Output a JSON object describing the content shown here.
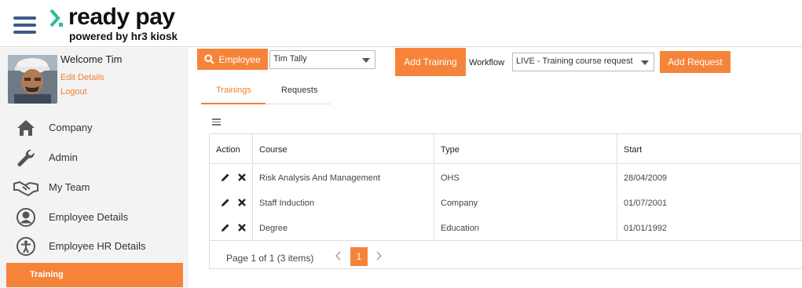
{
  "header": {
    "brand": "ready pay",
    "tagline": "powered by hr3 kiosk",
    "accent": "#f5843a",
    "menu_icon": "hamburger-icon"
  },
  "sidebar": {
    "welcome": "Welcome Tim",
    "edit_details": "Edit Details",
    "logout": "Logout",
    "items": [
      {
        "label": "Company",
        "icon": "home-icon"
      },
      {
        "label": "Admin",
        "icon": "wrench-icon"
      },
      {
        "label": "My Team",
        "icon": "handshake-icon"
      },
      {
        "label": "Employee Details",
        "icon": "user-circle-icon"
      },
      {
        "label": "Employee HR Details",
        "icon": "accessibility-icon"
      }
    ],
    "active_item": "Training"
  },
  "toolbar": {
    "employee_button": "Employee",
    "employee_value": "Tim Tally",
    "add_training": "Add Training",
    "workflow_label": "Workflow",
    "workflow_value": "LIVE - Training course request",
    "add_request": "Add Request"
  },
  "tabs": [
    {
      "label": "Trainings",
      "active": true
    },
    {
      "label": "Requests",
      "active": false
    }
  ],
  "grid": {
    "columns": [
      "Action",
      "Course",
      "Type",
      "Start"
    ],
    "rows": [
      {
        "course": "Risk Analysis And Management",
        "type": "OHS",
        "start": "28/04/2009"
      },
      {
        "course": "Staff Induction",
        "type": "Company",
        "start": "01/07/2001"
      },
      {
        "course": "Degree",
        "type": "Education",
        "start": "01/01/1992"
      }
    ],
    "pager_info": "Page 1 of 1 (3 items)",
    "current_page": "1"
  }
}
